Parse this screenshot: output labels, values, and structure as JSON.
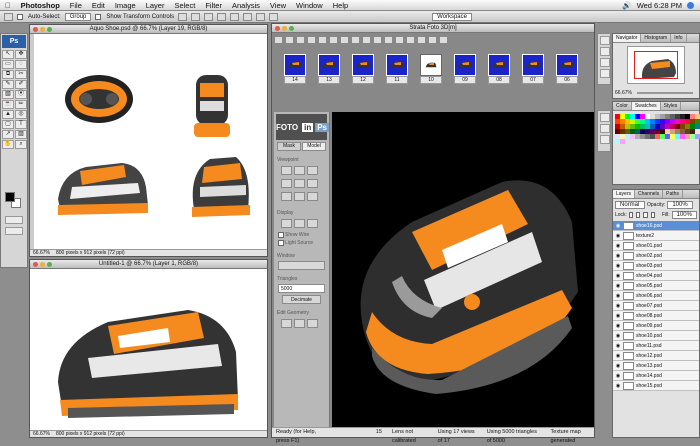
{
  "menubar": {
    "app_name": "Photoshop",
    "items": [
      "File",
      "Edit",
      "Image",
      "Layer",
      "Select",
      "Filter",
      "Analysis",
      "View",
      "Window",
      "Help"
    ],
    "clock": "Wed 6:28 PM"
  },
  "options_bar": {
    "auto_select_label": "Auto-Select:",
    "auto_select_value": "Group",
    "transform_label": "Show Transform Controls",
    "workspace_label": "Workspace"
  },
  "toolbox": {
    "logo": "Ps",
    "tools": [
      "↖",
      "✥",
      "▭",
      "◌",
      "⧉",
      "✂",
      "✎",
      "✐",
      "▧",
      "⦿",
      "☕",
      "✏",
      "▲",
      "◎",
      "▢",
      "T",
      "↗",
      "▨",
      "✋",
      "⌕"
    ]
  },
  "doc1": {
    "title": "Aquo Shoe.psd @ 66.7% (Layer 19, RGB/8)",
    "zoom": "66.67%",
    "info": "800 pixels x 912 pixels (72 ppi)"
  },
  "doc2": {
    "title": "Untitled-1 @ 66.7% (Layer 1, RGB/8)",
    "zoom": "66.67%",
    "info": "800 pixels x 912 pixels (72 ppi)"
  },
  "strata": {
    "title": "Strata Foto 3D[m]",
    "thumb_labels": [
      "14",
      "13",
      "12",
      "11",
      "10",
      "09",
      "08",
      "07",
      "06"
    ],
    "logo_left": "FOTO",
    "logo_mid": "in",
    "logo_right": "Ps",
    "tabs": [
      "Mask",
      "Model"
    ],
    "section_viewpoint": "Viewpoint",
    "section_display": "Display",
    "display_opt1": "Show Wire",
    "display_opt2": "Light Source",
    "section_window": "Window",
    "section_triangles": "Triangles",
    "triangles_value": "5000",
    "decimate_label": "Decimate",
    "section_edit": "Edit Geometry",
    "status_ready": "Ready (for Help, press F1)",
    "status_count": "15",
    "status_lens": "Lens not calibrated",
    "status_views": "Using 17 views of 17",
    "status_tris": "Using 5000 triangles of 5000",
    "status_tex": "Texture map generated"
  },
  "navigator": {
    "tabs": [
      "Navigator",
      "Histogram",
      "Info"
    ],
    "zoom": "66.67%"
  },
  "color_panel": {
    "tabs": [
      "Color",
      "Swatches",
      "Styles"
    ],
    "colors": [
      "#ff0000",
      "#ffff00",
      "#00ff00",
      "#00ffff",
      "#0000ff",
      "#ff00ff",
      "#ffffff",
      "#e0e0e0",
      "#c0c0c0",
      "#a0a0a0",
      "#808080",
      "#606060",
      "#404040",
      "#202020",
      "#000000",
      "#ff8080",
      "#ffc080",
      "#80ff80",
      "#ff4000",
      "#ff8000",
      "#ffc000",
      "#c0ff00",
      "#40ff40",
      "#00ff80",
      "#00c0ff",
      "#0080ff",
      "#0040ff",
      "#4000ff",
      "#8000ff",
      "#c000ff",
      "#ff00c0",
      "#ff0080",
      "#ff0040",
      "#804000",
      "#408000",
      "#004080",
      "#c00000",
      "#c06000",
      "#c0c000",
      "#60c000",
      "#00c000",
      "#00c060",
      "#00c0c0",
      "#0060c0",
      "#0000c0",
      "#6000c0",
      "#c000c0",
      "#c00060",
      "#800000",
      "#804000",
      "#808000",
      "#008000",
      "#008080",
      "#000080",
      "#600000",
      "#603000",
      "#606000",
      "#006000",
      "#006060",
      "#000060",
      "#300060",
      "#600060",
      "#600030",
      "#400000",
      "#ffd0a0",
      "#d0a080",
      "#a08060",
      "#806040",
      "#604020",
      "#402010",
      "#ffe0e0",
      "#e0ffe0",
      "#e0e0ff",
      "#fff0c0",
      "#c0f0ff",
      "#f0c0ff",
      "#b0b0b0",
      "#909090",
      "#707070",
      "#505050",
      "#ff6060",
      "#60ff60",
      "#6060ff",
      "#ffff60",
      "#60ffff",
      "#ff60ff",
      "#ffa0a0",
      "#a0ffa0",
      "#a0a0ff",
      "#ffffa0",
      "#a0ffff",
      "#ffa0ff"
    ]
  },
  "layers_panel": {
    "tabs": [
      "Layers",
      "Channels",
      "Paths"
    ],
    "blend_mode": "Normal",
    "opacity_label": "Opacity:",
    "opacity_value": "100%",
    "lock_label": "Lock:",
    "fill_label": "Fill:",
    "fill_value": "100%",
    "layers": [
      "shoe16.psd",
      "texture2",
      "shoe01.psd",
      "shoe02.psd",
      "shoe03.psd",
      "shoe04.psd",
      "shoe05.psd",
      "shoe06.psd",
      "shoe07.psd",
      "shoe08.psd",
      "shoe09.psd",
      "shoe10.psd",
      "shoe11.psd",
      "shoe12.psd",
      "shoe13.psd",
      "shoe14.psd",
      "shoe15.psd"
    ]
  }
}
